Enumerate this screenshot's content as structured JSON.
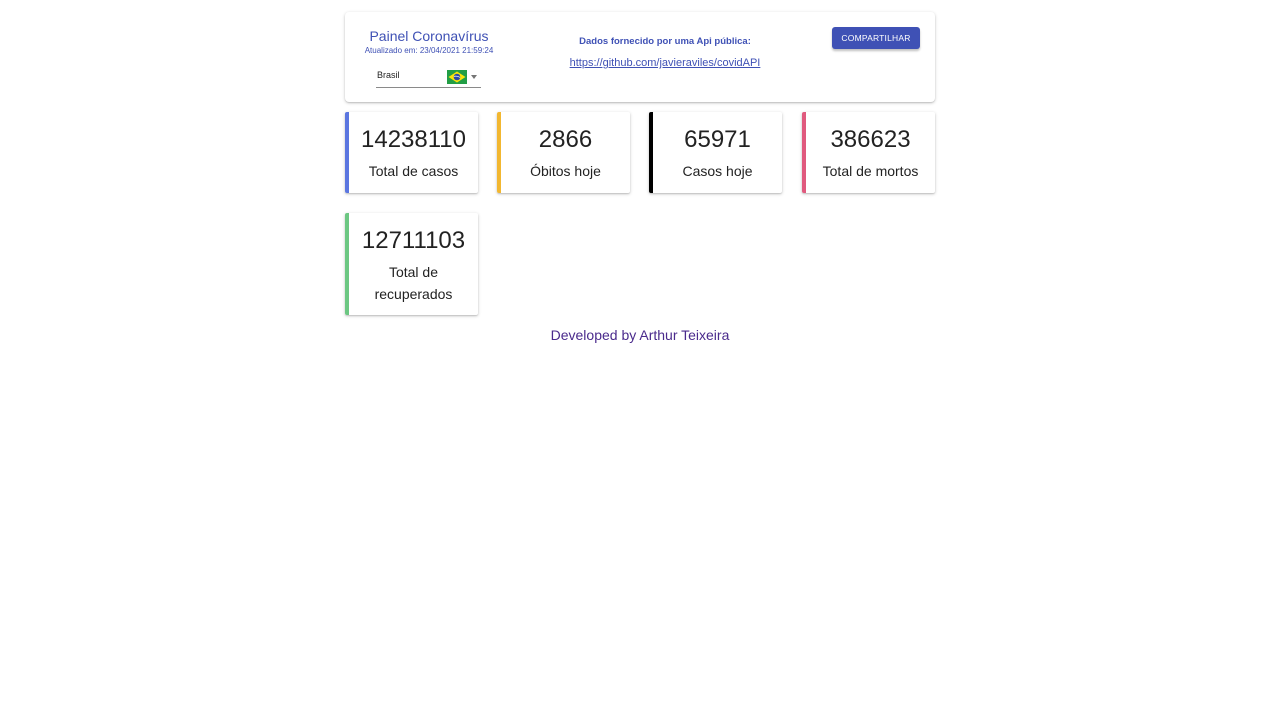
{
  "header": {
    "title": "Painel Coronavírus",
    "updated": "Atualizado em: 23/04/2021 21:59:24",
    "country": {
      "selected": "Brasil",
      "flag_icon": "brazil-flag-icon"
    },
    "api_label": "Dados fornecido por uma Api pública:",
    "api_link": "https://github.com/javieraviles/covidAPI",
    "share_label": "COMPARTILHAR"
  },
  "stats": [
    {
      "value": "14238110",
      "label": "Total de casos",
      "accent": "#5b76e0"
    },
    {
      "value": "2866",
      "label": "Óbitos hoje",
      "accent": "#f2b730"
    },
    {
      "value": "65971",
      "label": "Casos hoje",
      "accent": "#000000"
    },
    {
      "value": "386623",
      "label": "Total de mortos",
      "accent": "#e05a7e"
    },
    {
      "value": "12711103",
      "label": "Total de recuperados",
      "accent": "#6cc782"
    }
  ],
  "footer": {
    "credit": "Developed by Arthur Teixeira"
  },
  "colors": {
    "primary": "#3f51b5",
    "footer_text": "#4a2a8c"
  }
}
